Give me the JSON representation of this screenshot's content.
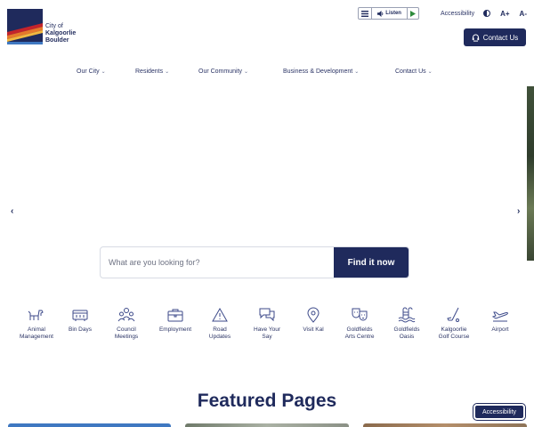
{
  "logo": {
    "line1": "City of",
    "line2": "Kalgoorlie",
    "line3": "Boulder"
  },
  "utility": {
    "listen_label": "Listen",
    "accessibility_label": "Accessibility",
    "font_increase": "A+",
    "font_decrease": "A-"
  },
  "contact_button": "Contact Us",
  "nav": [
    "Our City",
    "Residents",
    "Our Community",
    "Business & Development",
    "Contact Us"
  ],
  "carousel": {
    "prev": "‹",
    "next": "›"
  },
  "search": {
    "placeholder": "What are you looking for?",
    "button": "Find it now"
  },
  "quick_links": [
    {
      "line1": "Animal",
      "line2": "Management",
      "icon": "dog-icon"
    },
    {
      "line1": "Bin Days",
      "line2": "",
      "icon": "bin-icon"
    },
    {
      "line1": "Council",
      "line2": "Meetings",
      "icon": "people-icon"
    },
    {
      "line1": "Employment",
      "line2": "",
      "icon": "briefcase-icon"
    },
    {
      "line1": "Road",
      "line2": "Updates",
      "icon": "road-icon"
    },
    {
      "line1": "Have Your",
      "line2": "Say",
      "icon": "speech-icon"
    },
    {
      "line1": "Visit Kal",
      "line2": "",
      "icon": "map-pin-icon"
    },
    {
      "line1": "Goldfields",
      "line2": "Arts Centre",
      "icon": "theatre-masks-icon"
    },
    {
      "line1": "Goldfields",
      "line2": "Oasis",
      "icon": "pool-icon"
    },
    {
      "line1": "Kalgoorlie",
      "line2": "Golf Course",
      "icon": "golf-icon"
    },
    {
      "line1": "Airport",
      "line2": "",
      "icon": "plane-icon"
    }
  ],
  "featured_title": "Featured Pages",
  "accessibility_button": "Accessibility",
  "colors": {
    "primary": "#1f2a5c",
    "accent_orange": "#e6792b",
    "accent_red": "#c4232b",
    "accent_blue": "#3f78c1"
  }
}
